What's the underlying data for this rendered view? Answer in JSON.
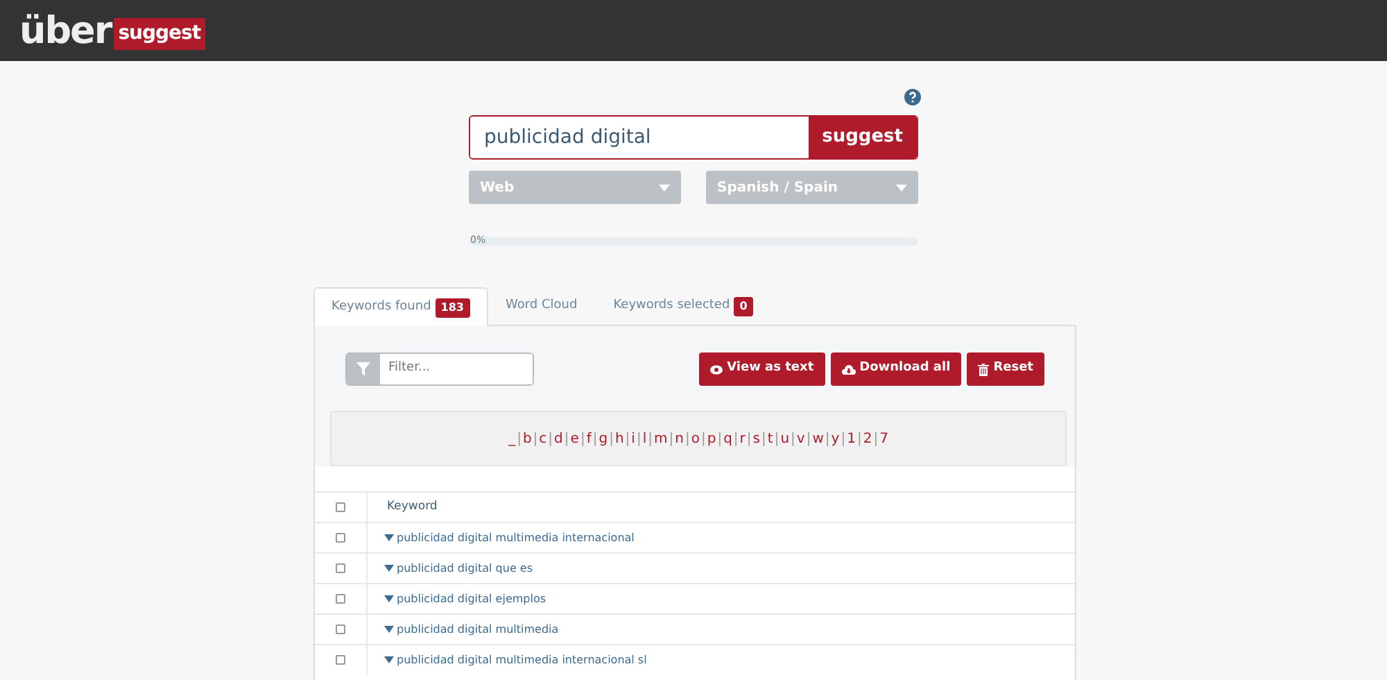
{
  "logo": {
    "word": "über",
    "tag": "suggest"
  },
  "search": {
    "value": "publicidad digital",
    "button": "suggest"
  },
  "selects": [
    {
      "value": "Web"
    },
    {
      "value": "Spanish / Spain"
    }
  ],
  "progress": {
    "level": 0,
    "reading": "0%"
  },
  "tabs": [
    {
      "label": "Keywords found",
      "count": "183",
      "selected": true
    },
    {
      "label": "Word Cloud",
      "selected": false
    },
    {
      "label": "Keywords selected",
      "count": "0",
      "selected": false
    }
  ],
  "filter": {
    "placeholder": "Filter..."
  },
  "actions": [
    {
      "kind": "view",
      "label": "View as text"
    },
    {
      "kind": "download",
      "label": "Download all"
    },
    {
      "kind": "reset",
      "label": "Reset"
    }
  ],
  "letters": {
    "separator": "|",
    "items": [
      "_",
      "b",
      "c",
      "d",
      "e",
      "f",
      "g",
      "h",
      "i",
      "l",
      "m",
      "n",
      "o",
      "p",
      "q",
      "r",
      "s",
      "t",
      "u",
      "v",
      "w",
      "y",
      "1",
      "2",
      "7"
    ]
  },
  "table": {
    "header": {
      "label": "Keyword",
      "checked": false
    },
    "rows": [
      {
        "keyword": "publicidad digital multimedia internacional",
        "checked": false
      },
      {
        "keyword": "publicidad digital que es",
        "checked": false
      },
      {
        "keyword": "publicidad digital ejemplos",
        "checked": false
      },
      {
        "keyword": "publicidad digital multimedia",
        "checked": false
      },
      {
        "keyword": "publicidad digital multimedia internacional sl",
        "checked": false
      }
    ]
  }
}
